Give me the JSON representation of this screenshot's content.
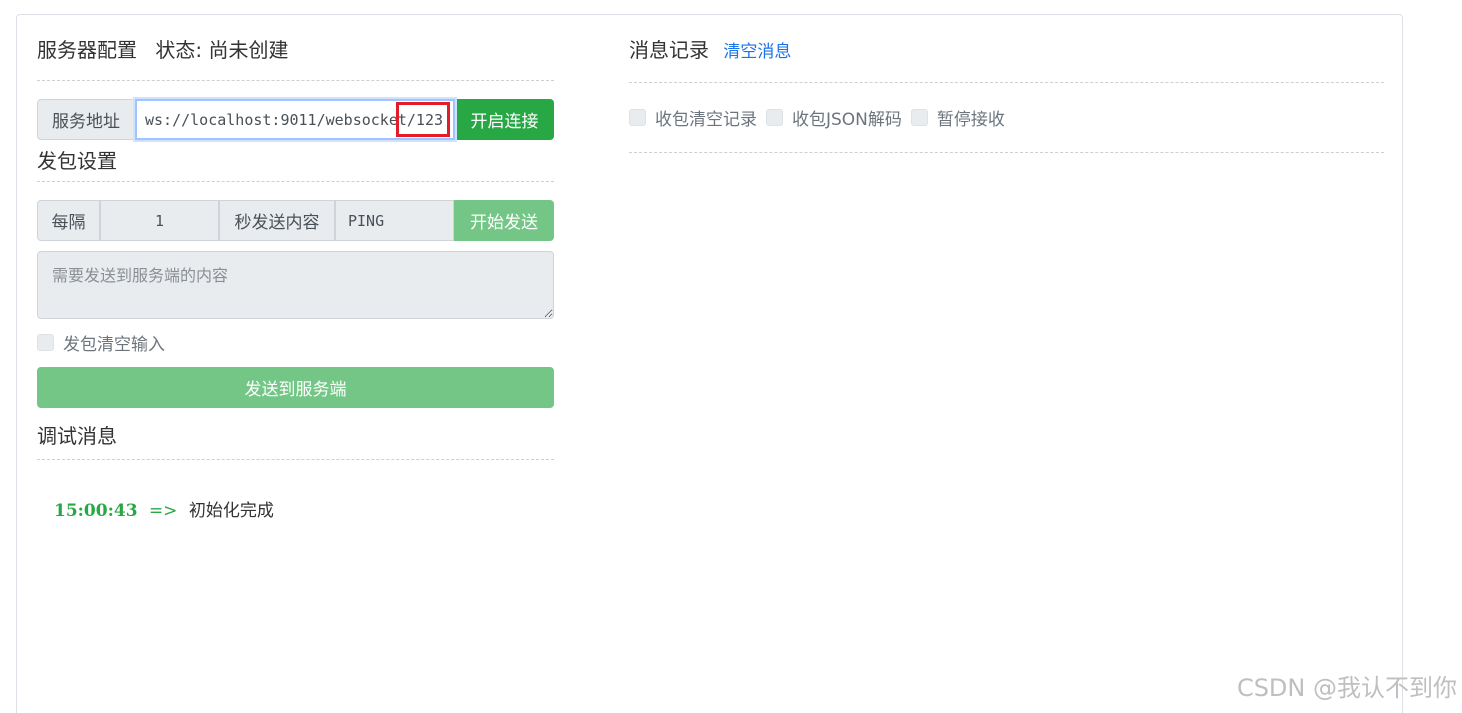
{
  "server": {
    "title": "服务器配置",
    "status_label": "状态:",
    "status_value": "尚未创建",
    "address_label": "服务地址",
    "url_value": "ws://localhost:9011/websocket/123",
    "connect_button": "开启连接"
  },
  "send_settings": {
    "title": "发包设置",
    "interval_prefix": "每隔",
    "interval_value": "1",
    "interval_suffix": "秒发送内容",
    "content_value": "PING",
    "start_button": "开始发送",
    "content_placeholder": "需要发送到服务端的内容",
    "clear_input_label": "发包清空输入",
    "send_button": "发送到服务端"
  },
  "debug": {
    "title": "调试消息",
    "logs": [
      {
        "time": "15:00:43",
        "arrow": "=>",
        "text": "初始化完成"
      }
    ]
  },
  "messages": {
    "title": "消息记录",
    "clear_link": "清空消息",
    "options": [
      "收包清空记录",
      "收包JSON解码",
      "暂停接收"
    ]
  },
  "watermark": "CSDN @我认不到你",
  "colors": {
    "primary_green": "#28a745",
    "light_green": "#74c686",
    "link_blue": "#1a73e8",
    "highlight_red": "#e11d2b"
  }
}
